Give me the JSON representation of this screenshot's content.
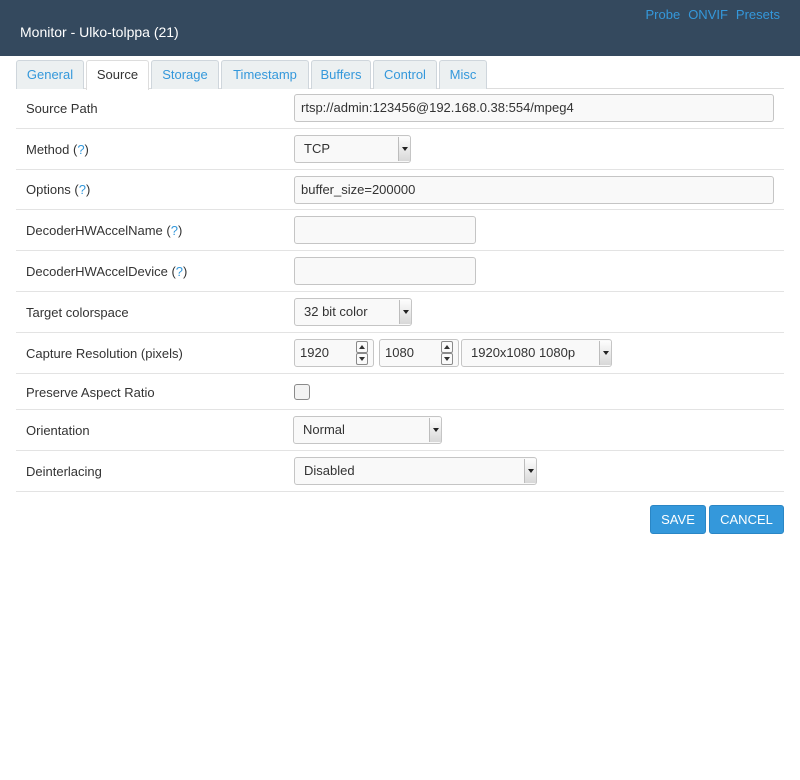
{
  "header": {
    "title": "Monitor - Ulko-tolppa (21)",
    "links": [
      "Probe",
      "ONVIF",
      "Presets"
    ]
  },
  "tabs": [
    "General",
    "Source",
    "Storage",
    "Timestamp",
    "Buffers",
    "Control",
    "Misc"
  ],
  "active_tab": "Source",
  "form": {
    "source_path": {
      "label": "Source Path",
      "value": "rtsp://admin:123456@192.168.0.38:554/mpeg4"
    },
    "method": {
      "label": "Method (",
      "help": "?",
      "label_end": ")",
      "value": "TCP"
    },
    "options": {
      "label": "Options (",
      "help": "?",
      "label_end": ")",
      "value": "buffer_size=200000"
    },
    "decoder_hw_accel_name": {
      "label": "DecoderHWAccelName (",
      "help": "?",
      "label_end": ")",
      "value": ""
    },
    "decoder_hw_accel_device": {
      "label": "DecoderHWAccelDevice (",
      "help": "?",
      "label_end": ")",
      "value": ""
    },
    "target_colorspace": {
      "label": "Target colorspace",
      "value": "32 bit color"
    },
    "capture_resolution": {
      "label": "Capture Resolution (pixels)",
      "width": "1920",
      "height": "1080",
      "preset": "1920x1080 1080p"
    },
    "preserve_aspect_ratio": {
      "label": "Preserve Aspect Ratio",
      "checked": false
    },
    "orientation": {
      "label": "Orientation",
      "value": "Normal"
    },
    "deinterlacing": {
      "label": "Deinterlacing",
      "value": "Disabled"
    }
  },
  "buttons": {
    "save": "SAVE",
    "cancel": "CANCEL"
  },
  "colors": {
    "header_bg": "#34495e",
    "accent": "#3498db",
    "tab_bg": "#ecf0f1"
  }
}
